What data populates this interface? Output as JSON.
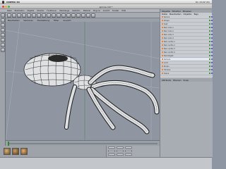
{
  "menubar": {
    "app": "CINEMA 4D",
    "clock": "Do 13:22 Uhr"
  },
  "window": {
    "title": "spinne.c4d *"
  },
  "menus": [
    "Datei",
    "Bearbeiten",
    "Objekte",
    "Struktur",
    "Funktionen",
    "Werkzeuge",
    "Selektion",
    "Material",
    "Plug-ins",
    "Ansicht",
    "Fenster",
    "Hilfe"
  ],
  "viewport_menu": [
    "Bearbeiten",
    "Kameras",
    "Darstellung",
    "Filter",
    "Ansicht"
  ],
  "right_panel": {
    "tabs": [
      "Objekte",
      "Struktur",
      "Browser"
    ],
    "menu": [
      "Datei",
      "Bearbeiten",
      "Objekte",
      "Tags"
    ],
    "objects": [
      "Spinne",
      "Körper",
      "Kopf",
      "Bein links 1",
      "Bein links 2",
      "Bein links 3",
      "Bein links 4",
      "Bein rechts 1",
      "Bein rechts 2",
      "Bein rechts 3",
      "Bein rechts 4",
      "Null-Objekt",
      "Kamera",
      "Licht",
      "Boden",
      "Himmel",
      "Szene"
    ],
    "selected_index": 12,
    "attr_tabs": [
      "Attribute",
      "Ebenen",
      "Snap"
    ]
  },
  "colors": {
    "accent": "#ff7a1a",
    "viewport_bg": "#8f96a1",
    "mesh": "#1c1c1c",
    "body_fill": "#dfe0e2"
  },
  "icons": [
    "cursor-icon",
    "move-icon",
    "scale-icon",
    "rotate-icon",
    "render-icon",
    "camera-icon",
    "light-icon",
    "deformer-icon"
  ]
}
